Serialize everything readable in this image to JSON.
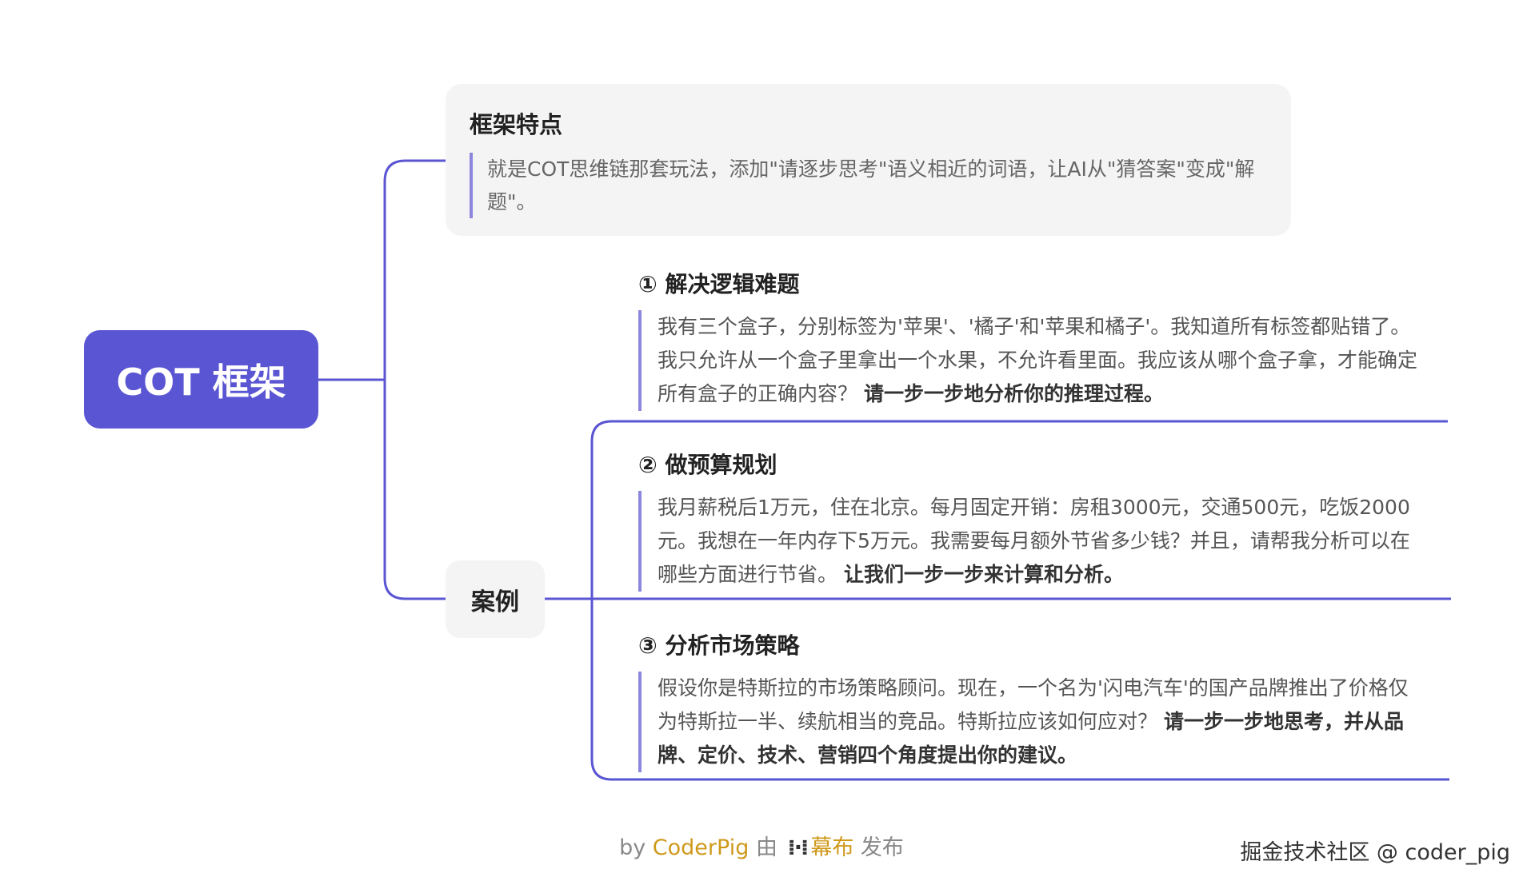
{
  "root": {
    "label": "COT 框架"
  },
  "feature": {
    "title": "框架特点",
    "text": "就是COT思维链那套玩法，添加\"请逐步思考\"语义相近的词语，让AI从\"猜答案\"变成\"解题\"。"
  },
  "cases": {
    "label": "案例",
    "items": [
      {
        "title": "① 解决逻辑难题",
        "text": "我有三个盒子，分别标签为'苹果'、'橘子'和'苹果和橘子'。我知道所有标签都贴错了。我只允许从一个盒子里拿出一个水果，不允许看里面。我应该从哪个盒子拿，才能确定所有盒子的正确内容？",
        "bold": "请一步一步地分析你的推理过程。"
      },
      {
        "title": "② 做预算规划",
        "text": "我月薪税后1万元，住在北京。每月固定开销：房租3000元，交通500元，吃饭2000元。我想在一年内存下5万元。我需要每月额外节省多少钱？并且，请帮我分析可以在哪些方面进行节省。",
        "bold": "让我们一步一步来计算和分析。"
      },
      {
        "title": "③ 分析市场策略",
        "text": "假设你是特斯拉的市场策略顾问。现在，一个名为'闪电汽车'的国产品牌推出了价格仅为特斯拉一半、续航相当的竞品。特斯拉应该如何应对？",
        "bold": "请一步一步地思考，并从品牌、定价、技术、营销四个角度提出你的建议。"
      }
    ]
  },
  "footer": {
    "by": "by",
    "author": "CoderPig",
    "mid": "由",
    "brand": "幕布",
    "tail": "发布"
  },
  "watermark": "掘金技术社区 @ coder_pig",
  "colors": {
    "accent": "#5a55d2",
    "quote_bar": "#8c87dd",
    "brand": "#cf9a1c"
  }
}
